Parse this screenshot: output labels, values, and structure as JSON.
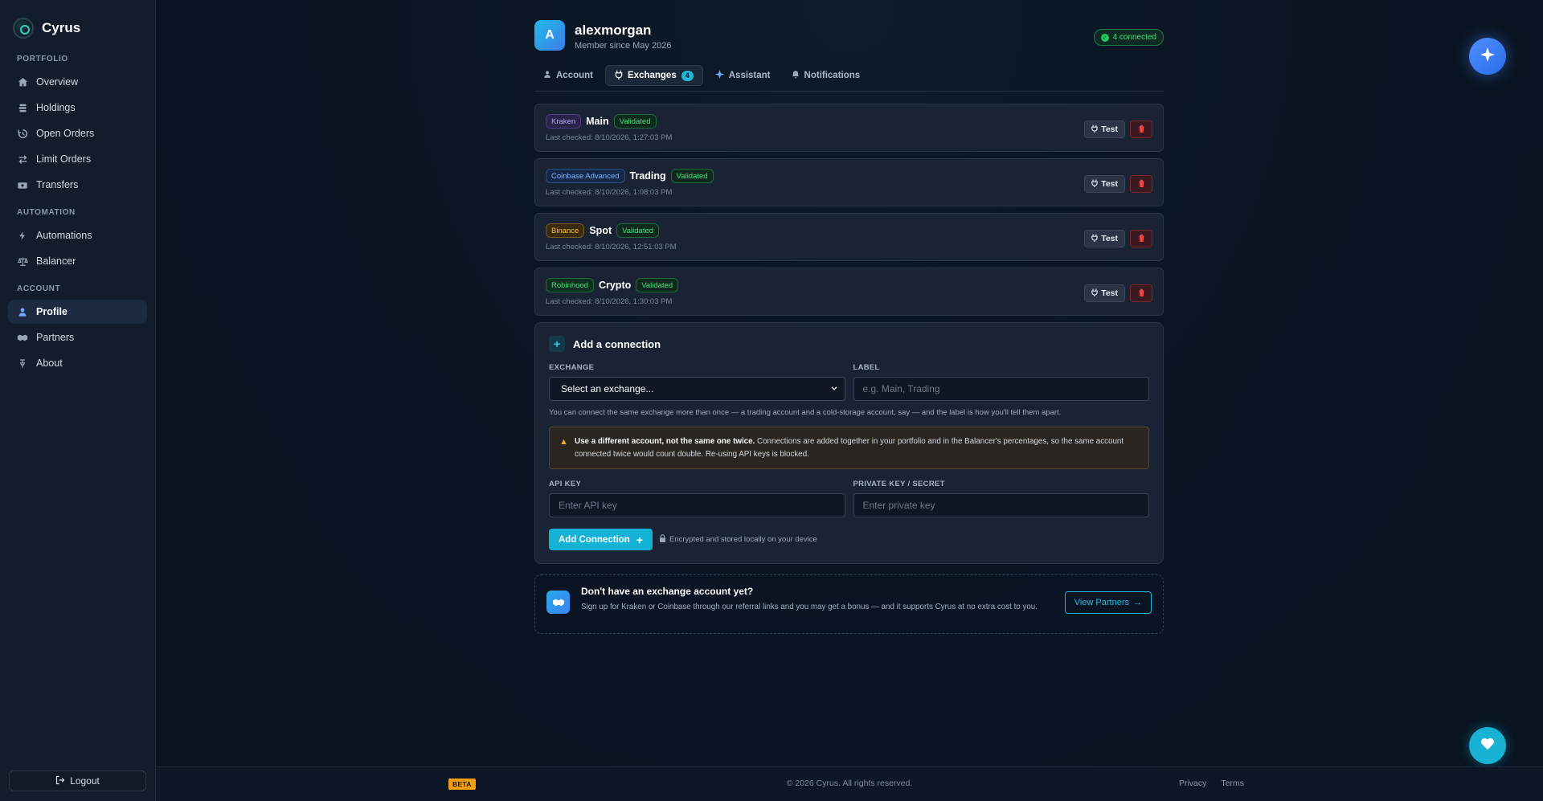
{
  "brand": {
    "name": "Cyrus"
  },
  "sidebar": {
    "sections": [
      {
        "heading": "PORTFOLIO",
        "items": [
          {
            "label": "Overview",
            "icon": "home-icon"
          },
          {
            "label": "Holdings",
            "icon": "layers-icon"
          },
          {
            "label": "Open Orders",
            "icon": "history-icon"
          },
          {
            "label": "Limit Orders",
            "icon": "swap-icon"
          },
          {
            "label": "Transfers",
            "icon": "money-icon"
          }
        ]
      },
      {
        "heading": "AUTOMATION",
        "items": [
          {
            "label": "Automations",
            "icon": "bolt-icon"
          },
          {
            "label": "Balancer",
            "icon": "scale-icon"
          }
        ]
      },
      {
        "heading": "ACCOUNT",
        "items": [
          {
            "label": "Profile",
            "icon": "user-icon",
            "active": true
          },
          {
            "label": "Partners",
            "icon": "handshake-icon"
          },
          {
            "label": "About",
            "icon": "pin-icon"
          }
        ]
      }
    ],
    "logout_label": "Logout"
  },
  "profile": {
    "avatar_letter": "A",
    "username": "alexmorgan",
    "member_since": "Member since May 2026",
    "connected_badge": "4 connected"
  },
  "tabs": [
    {
      "label": "Account",
      "icon": "user-icon"
    },
    {
      "label": "Exchanges",
      "icon": "plug-icon",
      "active": true,
      "count": "4"
    },
    {
      "label": "Assistant",
      "icon": "sparkle-icon"
    },
    {
      "label": "Notifications",
      "icon": "bell-icon"
    }
  ],
  "connections": [
    {
      "exchange": "Kraken",
      "exchange_style": "kraken",
      "label": "Main",
      "status": "Validated",
      "last_checked": "Last checked: 8/10/2026, 1:27:03 PM"
    },
    {
      "exchange": "Coinbase Advanced",
      "exchange_style": "coinbase",
      "label": "Trading",
      "status": "Validated",
      "last_checked": "Last checked: 8/10/2026, 1:08:03 PM"
    },
    {
      "exchange": "Binance",
      "exchange_style": "binance",
      "label": "Spot",
      "status": "Validated",
      "last_checked": "Last checked: 8/10/2026, 12:51:03 PM"
    },
    {
      "exchange": "Robinhood",
      "exchange_style": "robinhood",
      "label": "Crypto",
      "status": "Validated",
      "last_checked": "Last checked: 8/10/2026, 1:30:03 PM"
    }
  ],
  "connection_actions": {
    "test_label": "Test"
  },
  "add_connection": {
    "title": "Add a connection",
    "exchange_label": "EXCHANGE",
    "exchange_value": "Select an exchange...",
    "label_label": "LABEL",
    "label_placeholder": "e.g. Main, Trading",
    "hint": "You can connect the same exchange more than once — a trading account and a cold-storage account, say — and the label is how you'll tell them apart.",
    "warning_bold": "Use a different account, not the same one twice.",
    "warning_text": " Connections are added together in your portfolio and in the Balancer's percentages, so the same account connected twice would count double. Re-using API keys is blocked.",
    "api_key_label": "API KEY",
    "api_key_placeholder": "Enter API key",
    "secret_label": "PRIVATE KEY / SECRET",
    "secret_placeholder": "Enter private key",
    "submit_label": "Add Connection",
    "secure_note": "Encrypted and stored locally on your device"
  },
  "partners_promo": {
    "title": "Don't have an exchange account yet?",
    "description": "Sign up for Kraken or Coinbase through our referral links and you may get a bonus — and it supports Cyrus at no extra cost to you.",
    "button_label": "View Partners"
  },
  "footer": {
    "beta": "BETA",
    "copyright": "© 2026 Cyrus. All rights reserved.",
    "privacy": "Privacy",
    "terms": "Terms"
  },
  "colors": {
    "accent": "#14b3d6",
    "background": "#0b1220",
    "sidebar": "#131c2b",
    "success": "#4ade80",
    "danger": "#ef4444",
    "warning": "#f5a623"
  }
}
